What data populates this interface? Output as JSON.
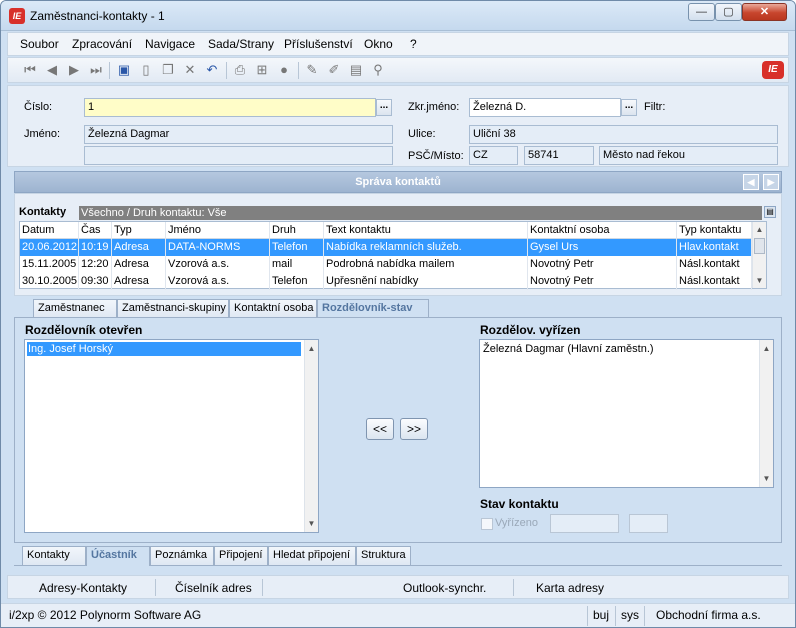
{
  "window": {
    "title": "Zaměstnanci-kontakty - 1",
    "logo_text": "IE"
  },
  "menu": [
    "Soubor",
    "Zpracování",
    "Navigace",
    "Sada/Strany",
    "Příslušenství",
    "Okno",
    "?"
  ],
  "toolbar": {
    "icons": [
      "first-record-icon",
      "prev-record-icon",
      "next-record-icon",
      "last-record-icon",
      "save-icon",
      "new-icon",
      "copy-icon",
      "delete-icon",
      "undo-icon",
      "print-icon",
      "tree-icon",
      "stop-icon",
      "edit-icon",
      "edit-alt-icon",
      "table-icon",
      "filter-icon"
    ],
    "brand_text": "IE"
  },
  "form": {
    "cislo_label": "Číslo:",
    "cislo_value": "1",
    "more_label": "...",
    "jmeno_label": "Jméno:",
    "jmeno_value": "Železná Dagmar",
    "jmeno_value2": "",
    "zkr_label": "Zkr.jméno:",
    "zkr_value": "Železná D.",
    "filtr_label": "Filtr:",
    "ulice_label": "Ulice:",
    "ulice_value": "Uliční 38",
    "psc_label": "PSČ/Místo:",
    "country": "CZ",
    "psc": "58741",
    "mesto": "Město nad řekou"
  },
  "section": {
    "title": "Správa kontaktů"
  },
  "contacts": {
    "label": "Kontakty",
    "filter": "Všechno / Druh kontaktu: Vše",
    "columns": [
      "Datum",
      "Čas",
      "Typ",
      "Jméno",
      "Druh",
      "Text kontaktu",
      "Kontaktní osoba",
      "Typ kontaktu"
    ],
    "rows": [
      [
        "20.06.2012",
        "10:19",
        "Adresa",
        "DATA-NORMS",
        "Telefon",
        "Nabídka reklamních služeb.",
        "Gysel Urs",
        "Hlav.kontakt"
      ],
      [
        "15.11.2005",
        "12:20",
        "Adresa",
        "Vzorová a.s.",
        "mail",
        "Podrobná nabídka mailem",
        "Novotný Petr",
        "Násl.kontakt"
      ],
      [
        "30.10.2005",
        "09:30",
        "Adresa",
        "Vzorová a.s.",
        "Telefon",
        "Upřesnění nabídky",
        "Novotný Petr",
        "Násl.kontakt"
      ]
    ]
  },
  "upper_tabs": [
    "Zaměstnanec",
    "Zaměstnanci-skupiny",
    "Kontaktní osoba",
    "Rozdělovník-stav"
  ],
  "distrib": {
    "open_title": "Rozdělovník otevřen",
    "open_items": [
      "Ing. Josef Horský"
    ],
    "done_title": "Rozdělov. vyřízen",
    "done_items": [
      "Železná Dagmar (Hlavní zaměstn.)"
    ],
    "btn_left": "<<",
    "btn_right": ">>",
    "status_title": "Stav kontaktu",
    "vyrizeno_label": "Vyřízeno"
  },
  "lower_tabs": [
    "Kontakty",
    "Účastník",
    "Poznámka",
    "Připojení",
    "Hledat připojení",
    "Struktura"
  ],
  "footer_buttons": [
    "Adresy-Kontakty",
    "Číselník adres",
    "Outlook-synchr.",
    "Karta adresy"
  ],
  "status": {
    "copyright": "i/2xp © 2012 Polynorm Software AG",
    "user": "buj",
    "db": "sys",
    "company": "Obchodní firma a.s."
  }
}
